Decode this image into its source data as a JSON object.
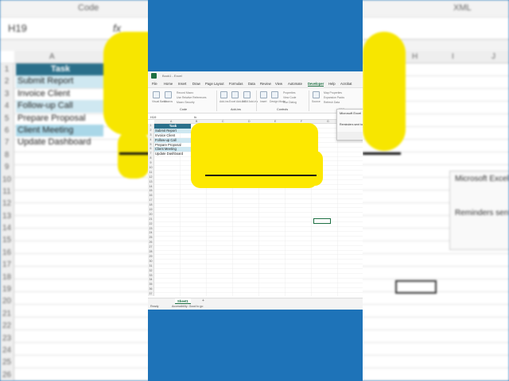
{
  "background": {
    "ribbon_labels": [
      "Code",
      "XML"
    ],
    "name_box": "H19",
    "fx": "fx",
    "columns": [
      "A",
      "H",
      "I",
      "J"
    ],
    "rows": [
      "1",
      "2",
      "3",
      "4",
      "5",
      "6",
      "7",
      "8",
      "9",
      "10",
      "11",
      "12",
      "13",
      "14",
      "15",
      "16",
      "17",
      "18",
      "19",
      "20",
      "21",
      "22",
      "23",
      "24",
      "25",
      "26"
    ],
    "dialog_title": "Microsoft Excel",
    "dialog_message": "Reminders sent to"
  },
  "window": {
    "title": "Book1 - Excel",
    "menu": [
      "File",
      "Home",
      "Insert",
      "Draw",
      "Page Layout",
      "Formulas",
      "Data",
      "Review",
      "View",
      "Automate",
      "Developer",
      "Help",
      "Acrobat"
    ],
    "active_menu": "Developer"
  },
  "ribbon": {
    "buttons": [
      "Visual Basic",
      "Macros",
      "Add-ins",
      "Excel Add-ins",
      "COM Add-ins",
      "Insert",
      "Design Mode",
      "Source"
    ],
    "small_items": [
      "Record Macro",
      "Use Relative References",
      "Macro Security",
      "Properties",
      "View Code",
      "Run Dialog",
      "Map Properties",
      "Expansion Packs",
      "Refresh Data"
    ],
    "groups": [
      "Code",
      "Add-ins",
      "Controls",
      "XML"
    ]
  },
  "formula_bar": {
    "name_box": "H19",
    "fx": "fx",
    "value": ""
  },
  "sheet": {
    "columns": [
      "A",
      "B",
      "C",
      "D",
      "E",
      "F",
      "G",
      "H"
    ],
    "rows": [
      "1",
      "2",
      "3",
      "4",
      "5",
      "6",
      "7",
      "8",
      "9",
      "10",
      "11",
      "12",
      "13",
      "14",
      "15",
      "16",
      "17",
      "18",
      "19",
      "20",
      "21",
      "22",
      "23",
      "24",
      "25",
      "26",
      "27",
      "28",
      "29",
      "30",
      "31",
      "32",
      "33",
      "34",
      "35",
      "36",
      "37"
    ],
    "header": "Task",
    "tasks": [
      "Submit Report",
      "Invoice Client",
      "Follow-up Call",
      "Prepare Proposal",
      "Client Meeting",
      "Update Dashboard"
    ],
    "active_tab": "Sheet1",
    "add_tab": "+"
  },
  "status_bar": {
    "left": "Ready",
    "accessibility": "Accessibility: Good to go"
  },
  "message_box": {
    "title": "Microsoft Excel",
    "message": "Reminders sent to"
  },
  "colors": {
    "header": "#2a6f8a",
    "band": "#cfe8f1",
    "yellow": "#fde800",
    "frame": "#1e73b8",
    "excel_green": "#1d6f42"
  }
}
